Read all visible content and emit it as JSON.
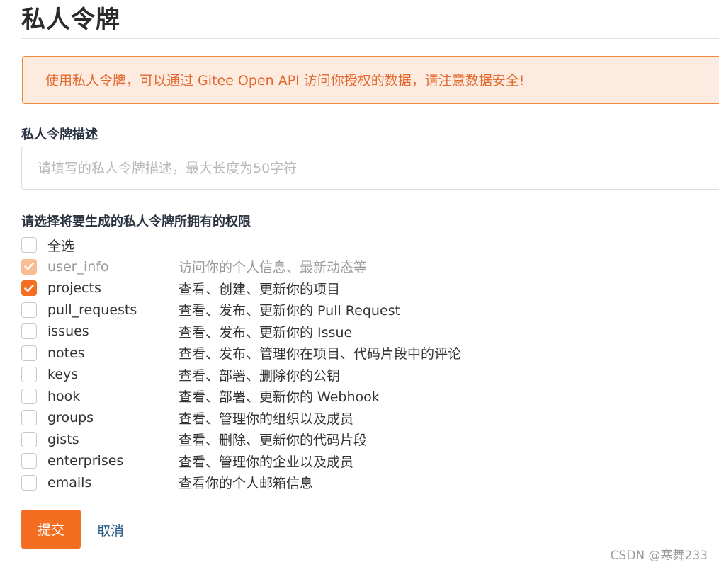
{
  "page": {
    "title": "私人令牌"
  },
  "notice": {
    "text": "使用私人令牌，可以通过 Gitee Open API 访问你授权的数据，请注意数据安全!"
  },
  "description_field": {
    "label": "私人令牌描述",
    "placeholder": "请填写的私人令牌描述，最大长度为50字符",
    "value": ""
  },
  "permissions": {
    "label": "请选择将要生成的私人令牌所拥有的权限",
    "select_all": {
      "label": "全选",
      "checked": false
    },
    "items": [
      {
        "name": "user_info",
        "description": "访问你的个人信息、最新动态等",
        "checked": true,
        "disabled": true
      },
      {
        "name": "projects",
        "description": "查看、创建、更新你的项目",
        "checked": true,
        "disabled": false
      },
      {
        "name": "pull_requests",
        "description": "查看、发布、更新你的 Pull Request",
        "checked": false,
        "disabled": false
      },
      {
        "name": "issues",
        "description": "查看、发布、更新你的 Issue",
        "checked": false,
        "disabled": false
      },
      {
        "name": "notes",
        "description": "查看、发布、管理你在项目、代码片段中的评论",
        "checked": false,
        "disabled": false
      },
      {
        "name": "keys",
        "description": "查看、部署、删除你的公钥",
        "checked": false,
        "disabled": false
      },
      {
        "name": "hook",
        "description": "查看、部署、更新你的 Webhook",
        "checked": false,
        "disabled": false
      },
      {
        "name": "groups",
        "description": "查看、管理你的组织以及成员",
        "checked": false,
        "disabled": false
      },
      {
        "name": "gists",
        "description": "查看、删除、更新你的代码片段",
        "checked": false,
        "disabled": false
      },
      {
        "name": "enterprises",
        "description": "查看、管理你的企业以及成员",
        "checked": false,
        "disabled": false
      },
      {
        "name": "emails",
        "description": "查看你的个人邮箱信息",
        "checked": false,
        "disabled": false
      }
    ]
  },
  "actions": {
    "submit_label": "提交",
    "cancel_label": "取消"
  },
  "watermark": {
    "text": "CSDN @寒舞233"
  },
  "colors": {
    "accent": "#f46e21",
    "notice_bg": "#fdebe0",
    "notice_border": "#f0883e",
    "notice_text": "#e2692d",
    "link": "#2d5c88"
  },
  "icons": {
    "checkbox_checked": "check-icon"
  }
}
